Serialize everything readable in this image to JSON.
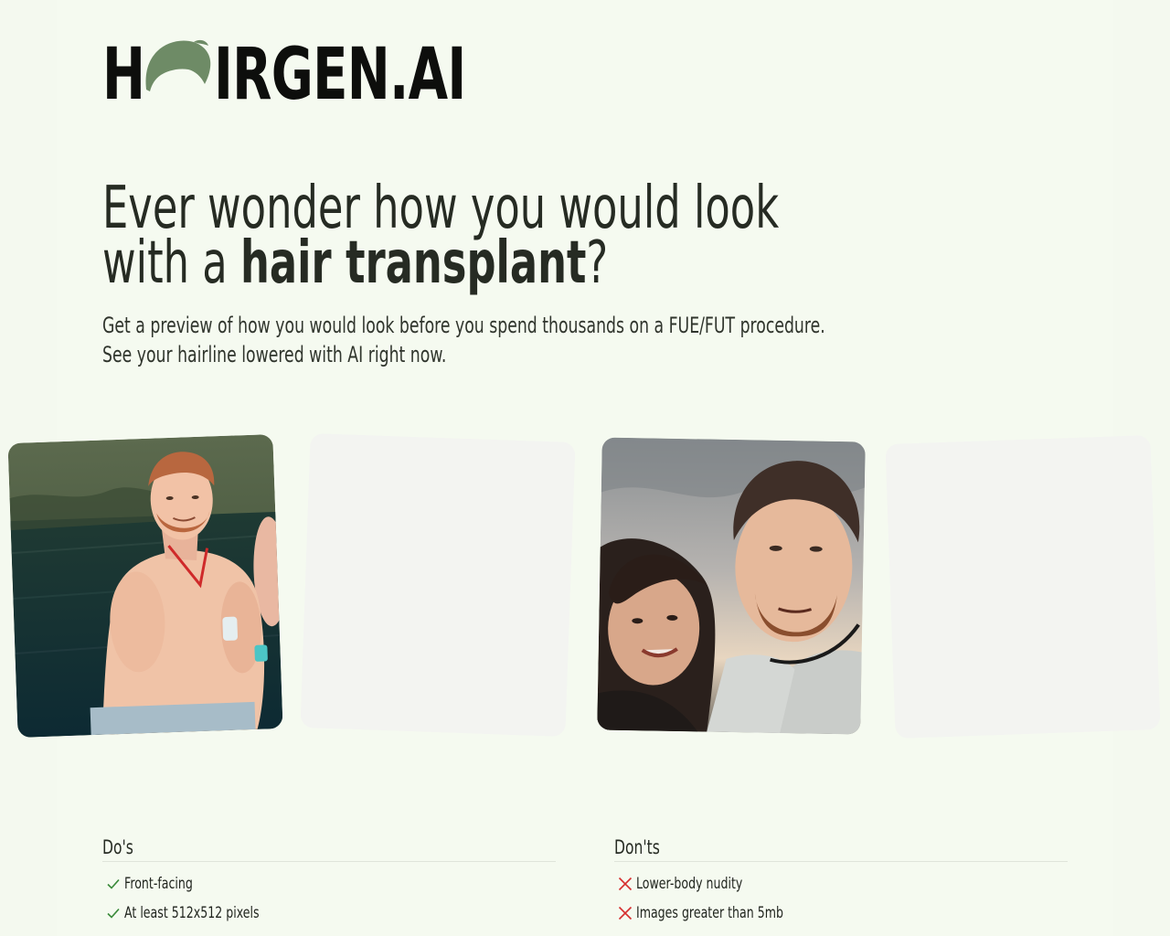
{
  "brand": {
    "logo_left": "H",
    "logo_right": "IRGEN.AI",
    "logo_full": "HAIRGEN.AI",
    "hair_color": "#6e8b66",
    "text_color": "#0d0e0c"
  },
  "hero": {
    "title_line1": "Ever wonder how you would look",
    "title_line2_prefix": "with a ",
    "title_line2_bold": "hair transplant",
    "title_line2_suffix": "?",
    "subtitle": "Get a preview of how you would look before you spend thousands on a FUE/FUT procedure. See your hairline lowered with AI right now."
  },
  "gallery": [
    {
      "kind": "photo",
      "icon": "man-in-water-photo"
    },
    {
      "kind": "placeholder"
    },
    {
      "kind": "photo",
      "icon": "couple-selfie-photo"
    },
    {
      "kind": "placeholder"
    }
  ],
  "dos": {
    "heading": "Do's",
    "items": [
      "Front-facing",
      "At least 512x512 pixels"
    ],
    "icon": "check-icon",
    "icon_color": "#3a8a3a"
  },
  "donts": {
    "heading": "Don'ts",
    "items": [
      "Lower-body nudity",
      "Images greater than 5mb"
    ],
    "icon": "x-icon",
    "icon_color": "#d62e2e"
  },
  "colors": {
    "background": "#f4f9ef",
    "placeholder_card": "#f3f4f1"
  }
}
